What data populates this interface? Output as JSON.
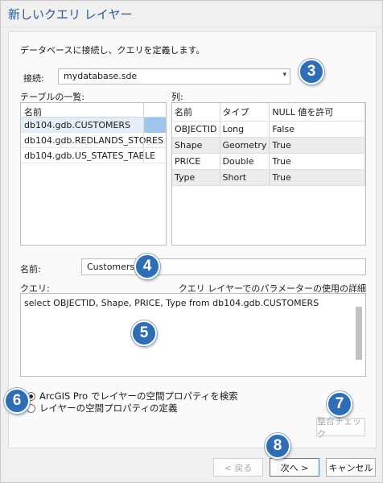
{
  "window": {
    "title": "新しいクエリ レイヤー"
  },
  "intro": "データベースに接続し、クエリを定義します。",
  "connection": {
    "label": "接続:",
    "value": "mydatabase.sde",
    "icon": "new-connection-icon"
  },
  "tables": {
    "label": "テーブルの一覧:",
    "header": "名前",
    "items": [
      "db104.gdb.CUSTOMERS",
      "db104.gdb.REDLANDS_STORES",
      "db104.gdb.US_STATES_TABLE"
    ]
  },
  "columns": {
    "label": "列:",
    "headers": [
      "名前",
      "タイプ",
      "NULL 値を許可"
    ],
    "rows": [
      [
        "OBJECTID",
        "Long",
        "False"
      ],
      [
        "Shape",
        "Geometry",
        "True"
      ],
      [
        "PRICE",
        "Double",
        "True"
      ],
      [
        "Type",
        "Short",
        "True"
      ]
    ]
  },
  "name": {
    "label": "名前:",
    "value": "Customers"
  },
  "query": {
    "label": "クエリ:",
    "help_link": "クエリ レイヤーでのパラメーターの使用の詳細",
    "text": "select OBJECTID, Shape, PRICE, Type from db104.gdb.CUSTOMERS"
  },
  "spatial": {
    "option_detect": "ArcGIS Pro でレイヤーの空間プロパティを検索",
    "option_define": "レイヤーの空間プロパティの定義",
    "selected": "detect"
  },
  "buttons": {
    "validate": "整合チェック",
    "back": "< 戻る",
    "next": "次へ >",
    "cancel": "キャンセル"
  },
  "callouts": [
    "3",
    "4",
    "5",
    "6",
    "7",
    "8"
  ],
  "colors": {
    "accent": "#2f6db5",
    "title": "#2b5797",
    "selection": "#9fc6ea"
  }
}
